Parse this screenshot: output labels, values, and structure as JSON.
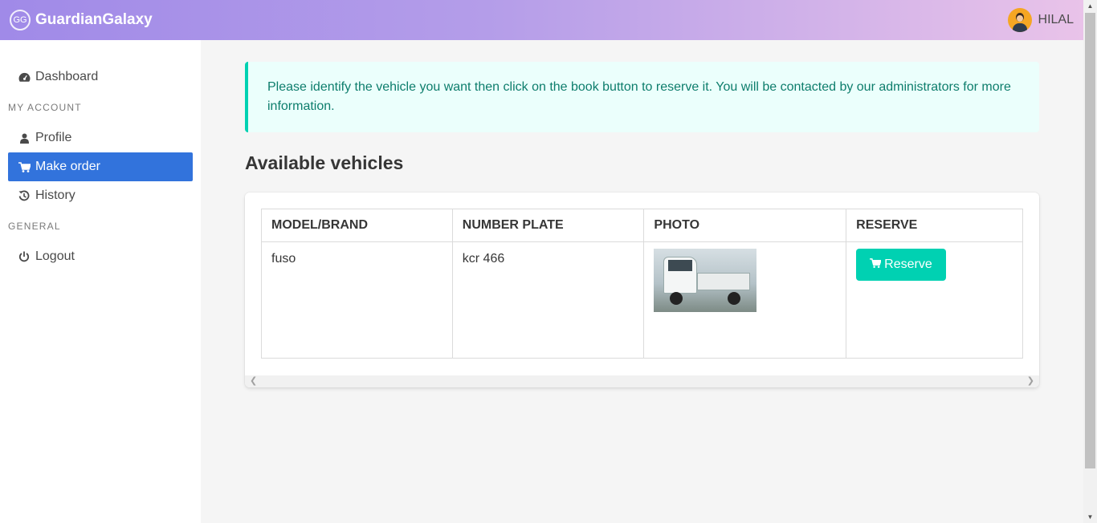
{
  "navbar": {
    "logo_text": "GG",
    "brand": "GuardianGalaxy",
    "username": "HILAL"
  },
  "sidebar": {
    "dashboard": "Dashboard",
    "section_account": "MY ACCOUNT",
    "profile": "Profile",
    "make_order": "Make order",
    "history": "History",
    "section_general": "GENERAL",
    "logout": "Logout"
  },
  "main": {
    "notice": "Please identify the vehicle you want then click on the book button to reserve it. You will be contacted by our administrators for more information.",
    "heading": "Available vehicles",
    "table": {
      "headers": [
        "MODEL/BRAND",
        "NUMBER PLATE",
        "PHOTO",
        "RESERVE"
      ],
      "rows": [
        {
          "model": "fuso",
          "plate": "kcr 466",
          "reserve_label": "Reserve"
        }
      ]
    }
  },
  "colors": {
    "accent": "#3273dc",
    "primary": "#00d1b2",
    "notice_bg": "#ebfffc"
  }
}
